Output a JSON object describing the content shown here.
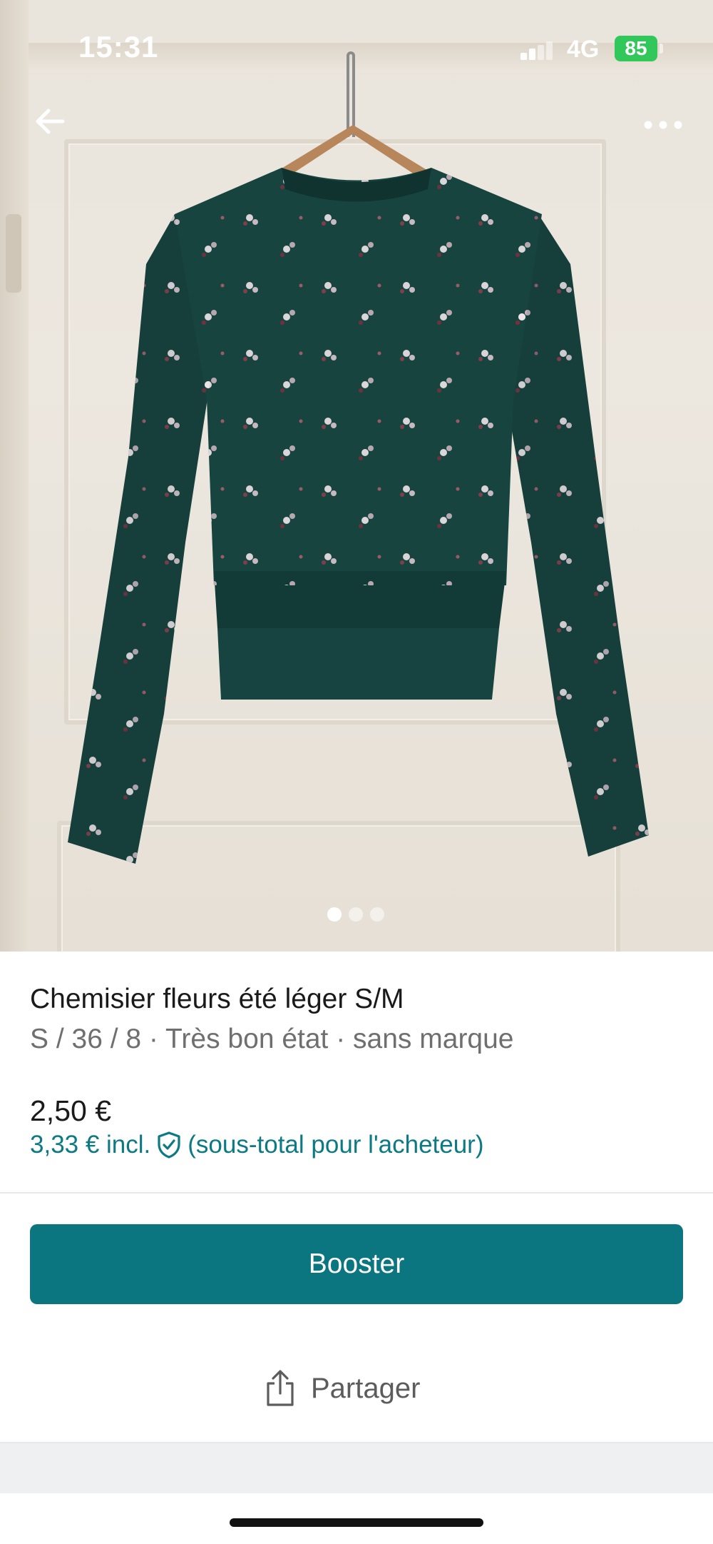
{
  "status_bar": {
    "time": "15:31",
    "network": "4G",
    "battery": "85"
  },
  "photo": {
    "description_icon": "floral-blouse-photo",
    "page_count": 3,
    "active_page": 1
  },
  "nav": {
    "back_icon": "arrow-left-icon",
    "more_icon": "more-horizontal-icon"
  },
  "item": {
    "title": "Chemisier fleurs été léger S/M",
    "subtitle": "S / 36 / 8 · Très bon état · sans marque",
    "price": "2,50 €",
    "price_incl": "3,33 € incl.",
    "price_incl_note": "(sous-total pour l'acheteur)",
    "protection_icon": "shield-check-icon"
  },
  "actions": {
    "boost_label": "Booster",
    "share_label": "Partager",
    "share_icon": "share-icon"
  },
  "colors": {
    "accent": "#0b7680",
    "link": "#0c7a83",
    "battery": "#31c75b"
  }
}
